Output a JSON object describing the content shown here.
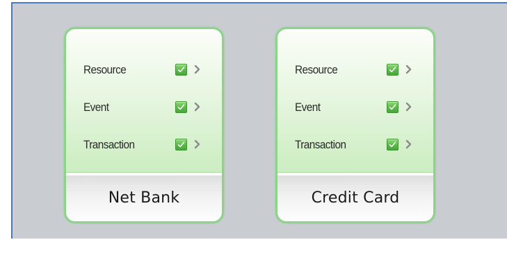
{
  "colors": {
    "background": "#c9cdd2",
    "frame_border": "#4a78c2",
    "card_border": "#8ed38a",
    "card_gradient_top": "#fbfdf9",
    "card_gradient_bottom": "#c2e8b5",
    "checkbox_fill": "#5cb84a",
    "chevron": "#8a8a8a"
  },
  "cards": [
    {
      "title": "Net Bank",
      "items": [
        {
          "label": "Resource",
          "checked": true,
          "icon": "chevron-right-icon"
        },
        {
          "label": "Event",
          "checked": true,
          "icon": "chevron-right-icon"
        },
        {
          "label": "Transaction",
          "checked": true,
          "icon": "chevron-right-icon"
        }
      ]
    },
    {
      "title": "Credit Card",
      "items": [
        {
          "label": "Resource",
          "checked": true,
          "icon": "chevron-right-icon"
        },
        {
          "label": "Event",
          "checked": true,
          "icon": "chevron-right-icon"
        },
        {
          "label": "Transaction",
          "checked": true,
          "icon": "chevron-right-icon"
        }
      ]
    }
  ]
}
